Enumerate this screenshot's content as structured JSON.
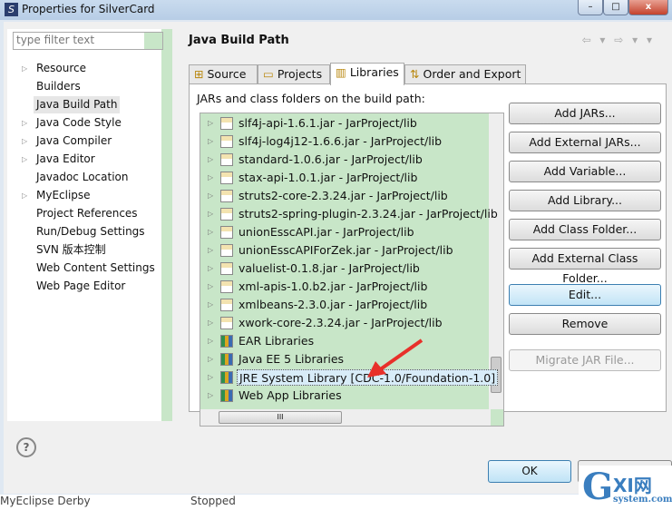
{
  "window": {
    "title": "Properties for SilverCard"
  },
  "sidebar": {
    "filter_placeholder": "type filter text",
    "items": [
      {
        "label": "Resource",
        "expandable": true
      },
      {
        "label": "Builders"
      },
      {
        "label": "Java Build Path",
        "selected": true
      },
      {
        "label": "Java Code Style",
        "expandable": true
      },
      {
        "label": "Java Compiler",
        "expandable": true
      },
      {
        "label": "Java Editor",
        "expandable": true
      },
      {
        "label": "Javadoc Location"
      },
      {
        "label": "MyEclipse",
        "expandable": true
      },
      {
        "label": "Project References"
      },
      {
        "label": "Run/Debug Settings"
      },
      {
        "label": "SVN 版本控制"
      },
      {
        "label": "Web Content Settings"
      },
      {
        "label": "Web Page Editor"
      }
    ]
  },
  "page": {
    "title": "Java Build Path",
    "nav": "⇦ ▾ ⇨ ▾ ▾",
    "tabs": [
      {
        "label": "Source",
        "icon": "⊞"
      },
      {
        "label": "Projects",
        "icon": "▭"
      },
      {
        "label": "Libraries",
        "icon": "▥"
      },
      {
        "label": "Order and Export",
        "icon": "⇅"
      }
    ],
    "description": "JARs and class folders on the build path:",
    "entries": [
      {
        "label": "slf4j-api-1.6.1.jar - JarProject/lib",
        "type": "jar"
      },
      {
        "label": "slf4j-log4j12-1.6.6.jar - JarProject/lib",
        "type": "jar"
      },
      {
        "label": "standard-1.0.6.jar - JarProject/lib",
        "type": "jar"
      },
      {
        "label": "stax-api-1.0.1.jar - JarProject/lib",
        "type": "jar"
      },
      {
        "label": "struts2-core-2.3.24.jar - JarProject/lib",
        "type": "jar"
      },
      {
        "label": "struts2-spring-plugin-2.3.24.jar - JarProject/lib",
        "type": "jar"
      },
      {
        "label": "unionEsscAPI.jar - JarProject/lib",
        "type": "jar"
      },
      {
        "label": "unionEsscAPIForZek.jar - JarProject/lib",
        "type": "jar"
      },
      {
        "label": "valuelist-0.1.8.jar - JarProject/lib",
        "type": "jar"
      },
      {
        "label": "xml-apis-1.0.b2.jar - JarProject/lib",
        "type": "jar"
      },
      {
        "label": "xmlbeans-2.3.0.jar - JarProject/lib",
        "type": "jar"
      },
      {
        "label": "xwork-core-2.3.24.jar - JarProject/lib",
        "type": "jar"
      },
      {
        "label": "EAR Libraries",
        "type": "lib"
      },
      {
        "label": "Java EE 5 Libraries",
        "type": "lib"
      },
      {
        "label": "JRE System Library [CDC-1.0/Foundation-1.0]",
        "type": "lib",
        "selected": true
      },
      {
        "label": "Web App Libraries",
        "type": "lib"
      }
    ],
    "buttons": [
      {
        "label": "Add JARs..."
      },
      {
        "label": "Add External JARs..."
      },
      {
        "label": "Add Variable..."
      },
      {
        "label": "Add Library..."
      },
      {
        "label": "Add Class Folder..."
      },
      {
        "label": "Add External Class Folder..."
      },
      {
        "label": "Edit...",
        "focused": true
      },
      {
        "label": "Remove"
      },
      {
        "label": "Migrate JAR File...",
        "disabled": true
      }
    ]
  },
  "footer": {
    "help": "?",
    "ok": "OK"
  },
  "taskbar": {
    "left": "MyEclipse Derby",
    "right": "Stopped"
  },
  "watermark": {
    "text": "GXI网 system.com"
  },
  "colors": {
    "list_bg": "#c8e6c8",
    "accent": "#3c7fb1",
    "arrow": "#e8302a"
  }
}
